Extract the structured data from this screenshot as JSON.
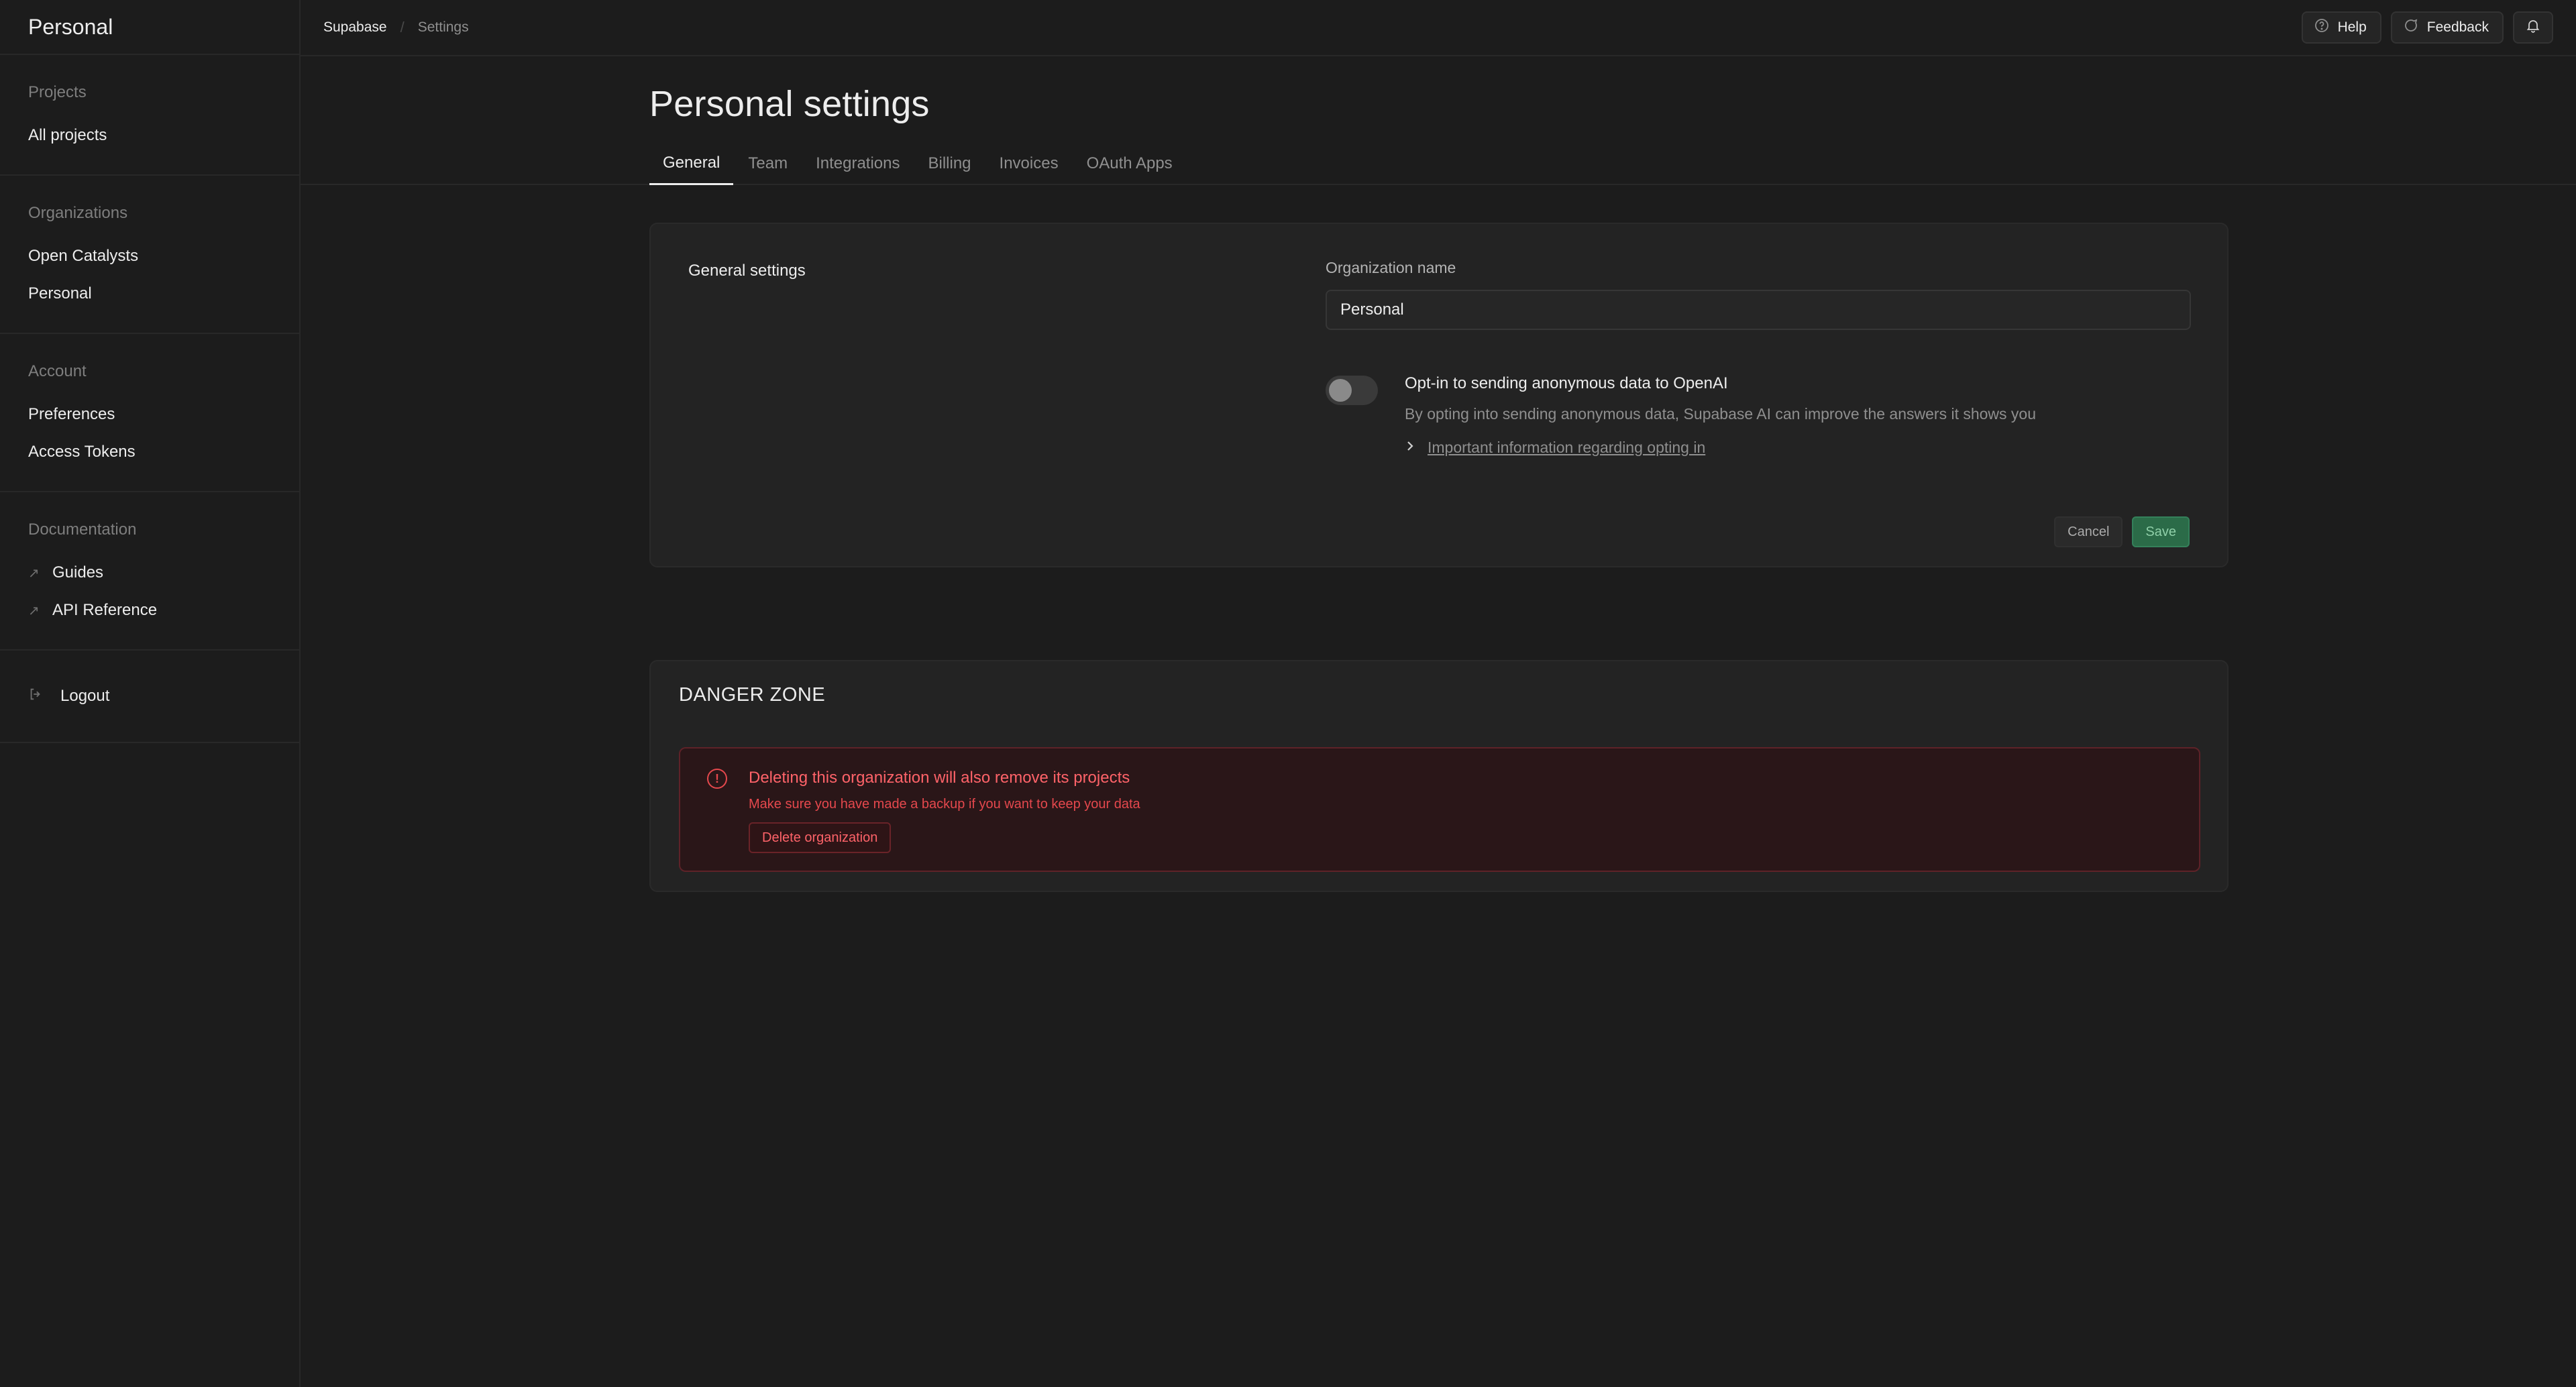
{
  "sidebar": {
    "title": "Personal",
    "sections": {
      "projects": {
        "label": "Projects",
        "items": [
          "All projects"
        ]
      },
      "organizations": {
        "label": "Organizations",
        "items": [
          "Open Catalysts",
          "Personal"
        ]
      },
      "account": {
        "label": "Account",
        "items": [
          "Preferences",
          "Access Tokens"
        ]
      },
      "documentation": {
        "label": "Documentation",
        "items": [
          "Guides",
          "API Reference"
        ]
      }
    },
    "logout": "Logout"
  },
  "topbar": {
    "breadcrumb": [
      "Supabase",
      "Settings"
    ],
    "help": "Help",
    "feedback": "Feedback"
  },
  "page": {
    "title": "Personal settings",
    "tabs": [
      "General",
      "Team",
      "Integrations",
      "Billing",
      "Invoices",
      "OAuth Apps"
    ],
    "active_tab": "General"
  },
  "general": {
    "section_label": "General settings",
    "org_name_label": "Organization name",
    "org_name_value": "Personal",
    "optin_title": "Opt-in to sending anonymous data to OpenAI",
    "optin_desc": "By opting into sending anonymous data, Supabase AI can improve the answers it shows you",
    "optin_link": "Important information regarding opting in",
    "optin_enabled": false,
    "cancel": "Cancel",
    "save": "Save"
  },
  "danger": {
    "title": "DANGER ZONE",
    "heading": "Deleting this organization will also remove its projects",
    "sub": "Make sure you have made a backup if you want to keep your data",
    "delete_button": "Delete organization"
  },
  "icons": {
    "help": "help-circle-icon",
    "feedback": "message-bubble-icon",
    "notifications": "bell-icon",
    "external": "arrow-up-right-icon",
    "logout": "logout-icon",
    "warning": "alert-circle-icon",
    "chevron": "chevron-right-icon"
  },
  "colors": {
    "background": "#1c1c1c",
    "card": "#232323",
    "brand_green": "#2b6b48",
    "danger_red": "#e5484d"
  }
}
